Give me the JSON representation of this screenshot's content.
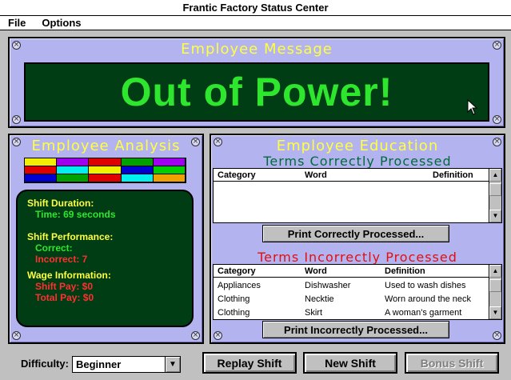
{
  "window": {
    "title": "Frantic Factory Status Center"
  },
  "menu": {
    "file": "File",
    "options": "Options"
  },
  "message_panel": {
    "title": "Employee Message",
    "message": "Out of Power!"
  },
  "analysis_panel": {
    "title": "Employee Analysis",
    "swatch_colors": [
      "#f0f000",
      "#a000f0",
      "#e00000",
      "#00a000",
      "#a000f0",
      "#e00000",
      "#00f0f0",
      "#f0f000",
      "#0000d0",
      "#00d000",
      "#0000d0",
      "#00a000",
      "#e00000",
      "#00f0f0",
      "#f0a000"
    ],
    "shift_duration_label": "Shift Duration:",
    "time": "Time: 69 seconds",
    "shift_performance_label": "Shift Performance:",
    "correct": "Correct:",
    "incorrect": "Incorrect: 7",
    "wage_label": "Wage Information:",
    "shift_pay": "Shift Pay: $0",
    "total_pay": "Total Pay: $0"
  },
  "education_panel": {
    "title": "Employee Education",
    "correct_title": "Terms Correctly Processed",
    "incorrect_title": "Terms Incorrectly Processed",
    "columns": {
      "category": "Category",
      "word": "Word",
      "definition": "Definition"
    },
    "incorrect_rows": [
      {
        "category": "Appliances",
        "word": "Dishwasher",
        "definition": "Used to wash dishes"
      },
      {
        "category": "Clothing",
        "word": "Necktie",
        "definition": "Worn around the neck"
      },
      {
        "category": "Clothing",
        "word": "Skirt",
        "definition": "A woman's garment"
      }
    ],
    "print_correct": "Print Correctly Processed...",
    "print_incorrect": "Print Incorrectly Processed..."
  },
  "footer": {
    "difficulty_label": "Difficulty:",
    "difficulty_value": "Beginner",
    "replay": "Replay Shift",
    "new_shift": "New Shift",
    "bonus": "Bonus Shift"
  }
}
